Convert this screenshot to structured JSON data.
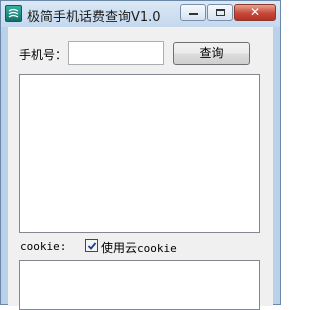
{
  "window": {
    "title": "极简手机话费查询V1.0",
    "icon": "app-logo-icon",
    "buttons": {
      "minimize": "minimize-icon",
      "maximize": "maximize-icon",
      "close": "close-icon"
    },
    "close_glyph": "✕"
  },
  "form": {
    "phone_label": "手机号：",
    "phone_value": "",
    "query_button": "查询",
    "result_text": "",
    "cookie_label": "cookie:",
    "use_cloud_cookie_prefix": "使用云",
    "use_cloud_cookie_suffix": "cookie",
    "use_cloud_cookie_checked": true,
    "cookie_value": ""
  },
  "colors": {
    "frame": "#b9d1ea",
    "client": "#f0f0f0",
    "close_button": "#c7483a"
  }
}
